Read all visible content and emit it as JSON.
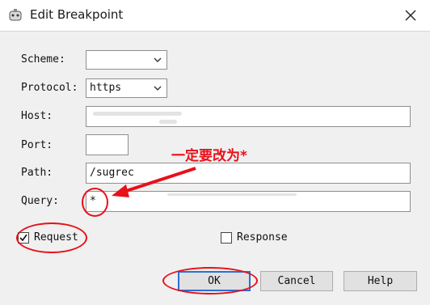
{
  "window": {
    "title": "Edit Breakpoint"
  },
  "labels": {
    "scheme": "Scheme:",
    "protocol": "Protocol:",
    "host": "Host:",
    "port": "Port:",
    "path": "Path:",
    "query": "Query:"
  },
  "fields": {
    "scheme_value": "",
    "protocol_value": "https",
    "host_value": "",
    "port_value": "",
    "path_value": "/sugrec",
    "query_value": "*"
  },
  "checkboxes": {
    "request": {
      "label": "Request",
      "checked": true
    },
    "response": {
      "label": "Response",
      "checked": false
    }
  },
  "buttons": {
    "ok": "OK",
    "cancel": "Cancel",
    "help": "Help"
  },
  "annotation": {
    "text": "一定要改为*"
  },
  "colors": {
    "annotation_red": "#e8101a",
    "default_button_border": "#2a6fd6"
  }
}
